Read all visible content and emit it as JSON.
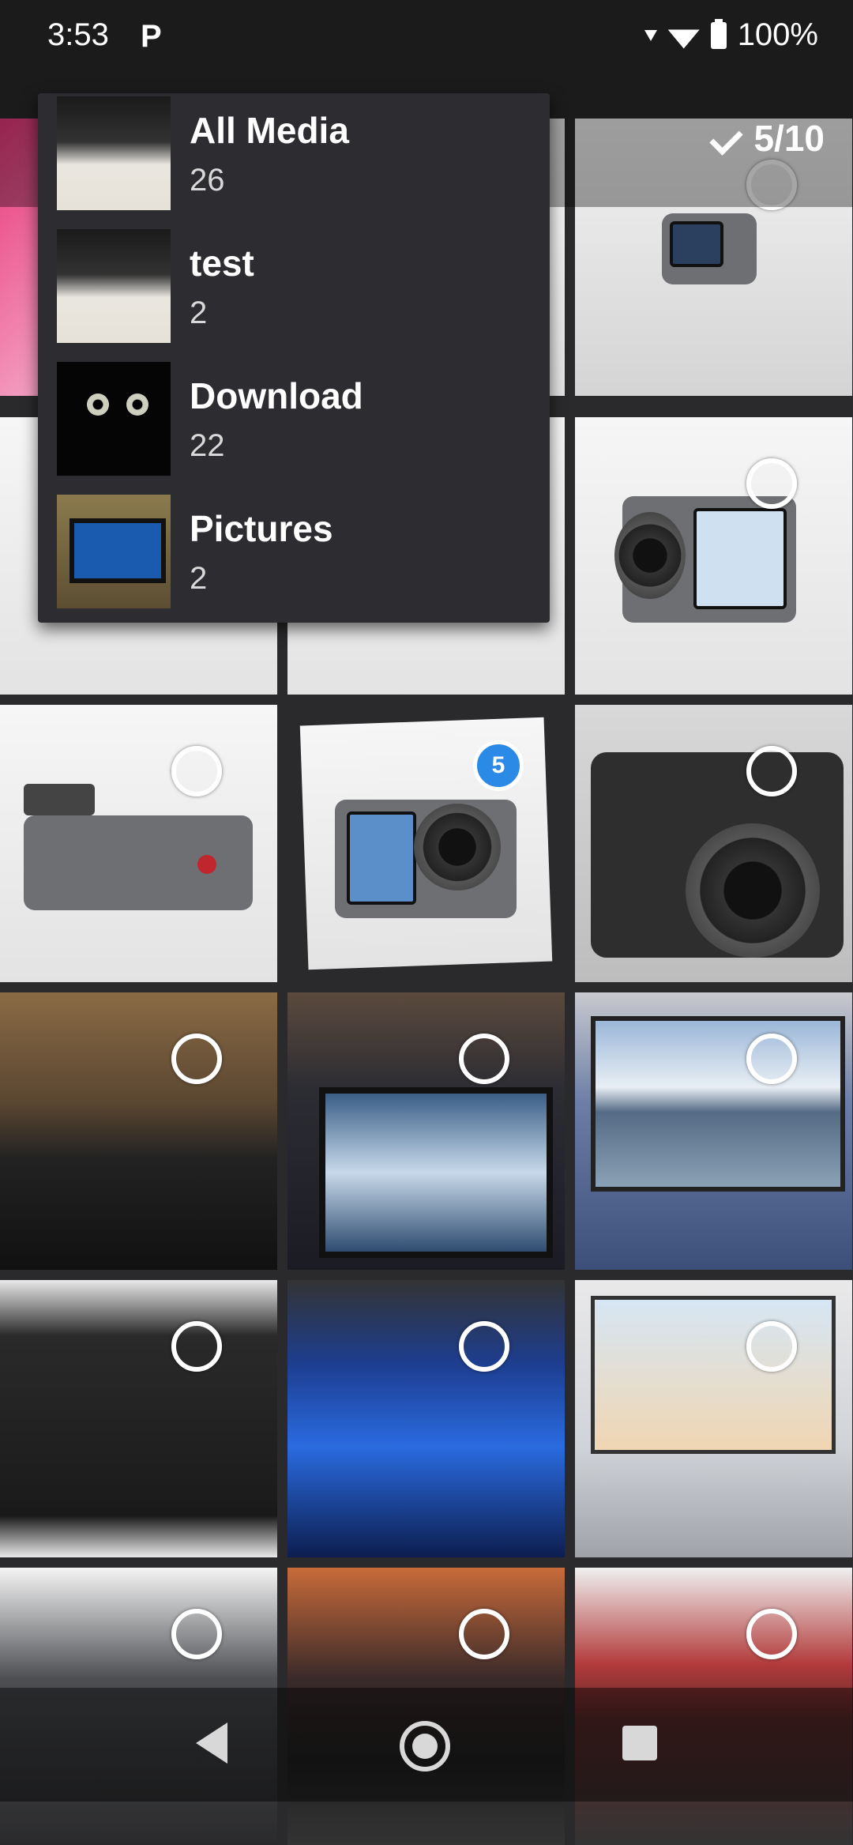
{
  "status_bar": {
    "time": "3:53",
    "app_badge": "P",
    "battery": "100%"
  },
  "toolbar": {
    "selected_counter": "5/10"
  },
  "albums": [
    {
      "name": "All Media",
      "count": "26",
      "thumb": "keyboard"
    },
    {
      "name": "test",
      "count": "2",
      "thumb": "keyboard"
    },
    {
      "name": "Download",
      "count": "22",
      "thumb": "cat"
    },
    {
      "name": "Pictures",
      "count": "2",
      "thumb": "phone"
    }
  ],
  "grid": {
    "selected_badge": "5"
  },
  "colors": {
    "accent": "#2b8ae6",
    "menu_bg": "#2d2c30"
  }
}
